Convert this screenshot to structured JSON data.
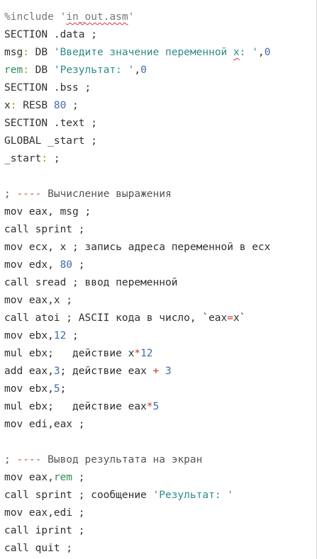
{
  "editor": {
    "lines": {
      "l0": {
        "pre": "%include '",
        "inc": "in_out.asm",
        "post": "'"
      },
      "l1": "SECTION .data ;",
      "l2": {
        "label": "msg",
        "colon": ":",
        "db": " DB ",
        "str1": "'Введите значение переменной ",
        "x": "x",
        "str2": ": '",
        "comma": ",",
        "num": "0"
      },
      "l3": {
        "label": "rem",
        "colon": ":",
        "db": " DB ",
        "str": "'Результат: '",
        "comma": ",",
        "num": "0"
      },
      "l4": "SECTION .bss ;",
      "l5": {
        "label": "x",
        "colon": ":",
        "rest": " RESB ",
        "num": "80",
        "tail": " ;"
      },
      "l6": "SECTION .text ;",
      "l7": "GLOBAL _start ;",
      "l8": {
        "label": "_start",
        "colon": ":",
        "tail": " ;"
      },
      "l10": {
        "semi": "; ",
        "dash": "----",
        "text": " Вычисление выражения"
      },
      "l11": "mov eax, msg ;",
      "l12": "call sprint ;",
      "l13": "mov ecx, x ; запись адреса переменной в ecx",
      "l14": {
        "pre": "mov edx, ",
        "num": "80",
        "tail": " ;"
      },
      "l15": "call sread ; ввод переменной",
      "l16": "mov eax,x ;",
      "l17": {
        "pre": "call atoi ; ASCII кода в число, `eax",
        "op": "=",
        "post": "x`"
      },
      "l18": {
        "pre": "mov ebx,",
        "num": "12",
        "tail": " ;"
      },
      "l19": {
        "pre": "mul ebx;   действие x",
        "op": "*",
        "num": "12"
      },
      "l20": {
        "pre": "add eax,",
        "num": "3",
        "mid": "; действие eax ",
        "op": "+",
        "sp": " ",
        "num2": "3"
      },
      "l21": {
        "pre": "mov ebx,",
        "num": "5",
        "tail": ";"
      },
      "l22": {
        "pre": "mul ebx;   действие eax",
        "op": "*",
        "num": "5"
      },
      "l23": "mov edi,eax ;",
      "l25": {
        "semi": "; ",
        "dash": "----",
        "text": " Вывод результата на экран"
      },
      "l26": {
        "pre": "mov eax,",
        "id": "rem",
        "tail": " ;"
      },
      "l27": {
        "pre": "call sprint ; сообщение ",
        "str": "'Результат: '"
      },
      "l28": "mov eax,edi ;",
      "l29": "call iprint ;",
      "l30": "call quit ;"
    }
  }
}
